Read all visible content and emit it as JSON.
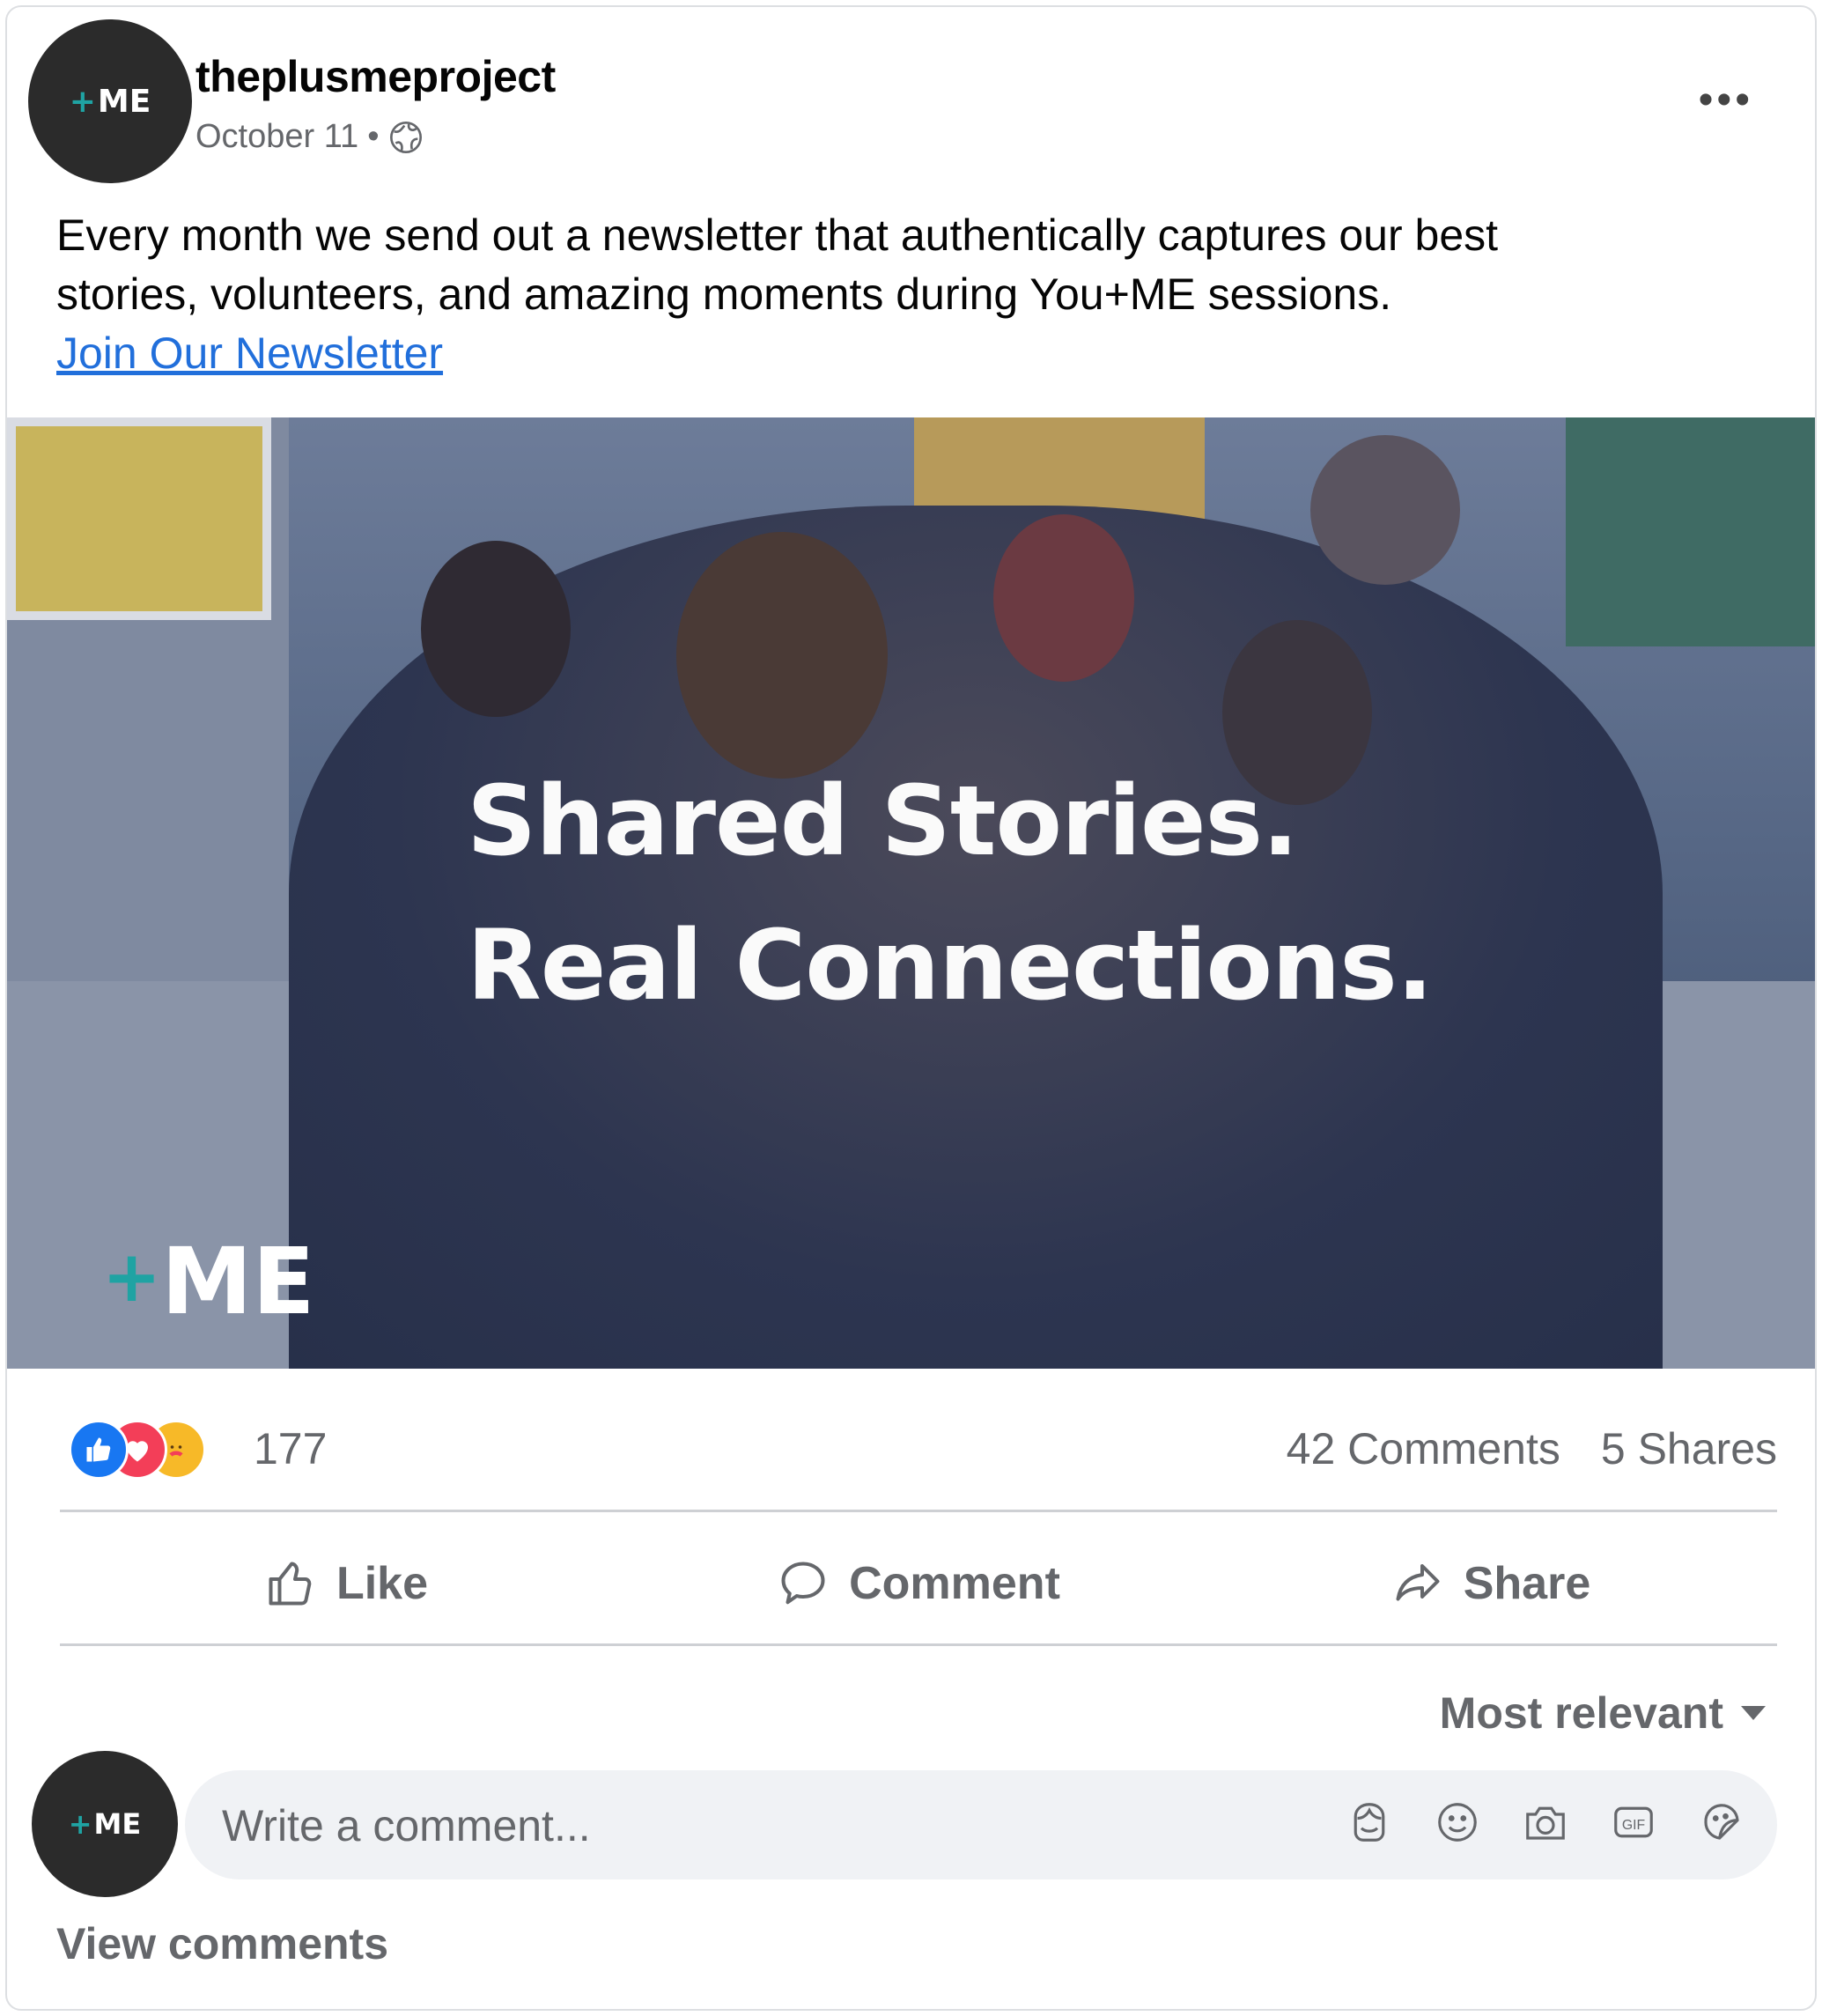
{
  "post": {
    "page_name": "theplusmeproject",
    "date": "October 11",
    "separator": "•",
    "privacy_icon": "globe-icon",
    "more_label": "•••",
    "text_line1": "Every month we send out a newsletter that authentically captures our best",
    "text_line2": "stories, volunteers, and amazing moments during You+ME sessions.",
    "link_text": "Join Our Newsletter",
    "link_color": "#216fdb"
  },
  "avatar": {
    "plus": "+",
    "text": "ME"
  },
  "photo": {
    "title_line1": "Shared Stories.",
    "title_line2": "Real Connections.",
    "logo_plus": "+",
    "logo_text": "ME"
  },
  "stats": {
    "reaction_icons": [
      "like-icon",
      "love-icon",
      "care-icon"
    ],
    "reaction_count": "177",
    "comments": "42 Comments",
    "shares": "5 Shares"
  },
  "actions": {
    "like": "Like",
    "comment": "Comment",
    "share": "Share"
  },
  "comments": {
    "sort_label": "Most relevant",
    "placeholder": "Write a comment...",
    "input_icons": [
      "avatar-sticker-icon",
      "emoji-icon",
      "camera-icon",
      "gif-icon",
      "sticker-icon"
    ],
    "view_comments": "View comments"
  },
  "colors": {
    "accent_teal": "#1fa3a3",
    "like_blue": "#1877f2",
    "love_red": "#f33e58",
    "secondary_text": "#65676b"
  }
}
